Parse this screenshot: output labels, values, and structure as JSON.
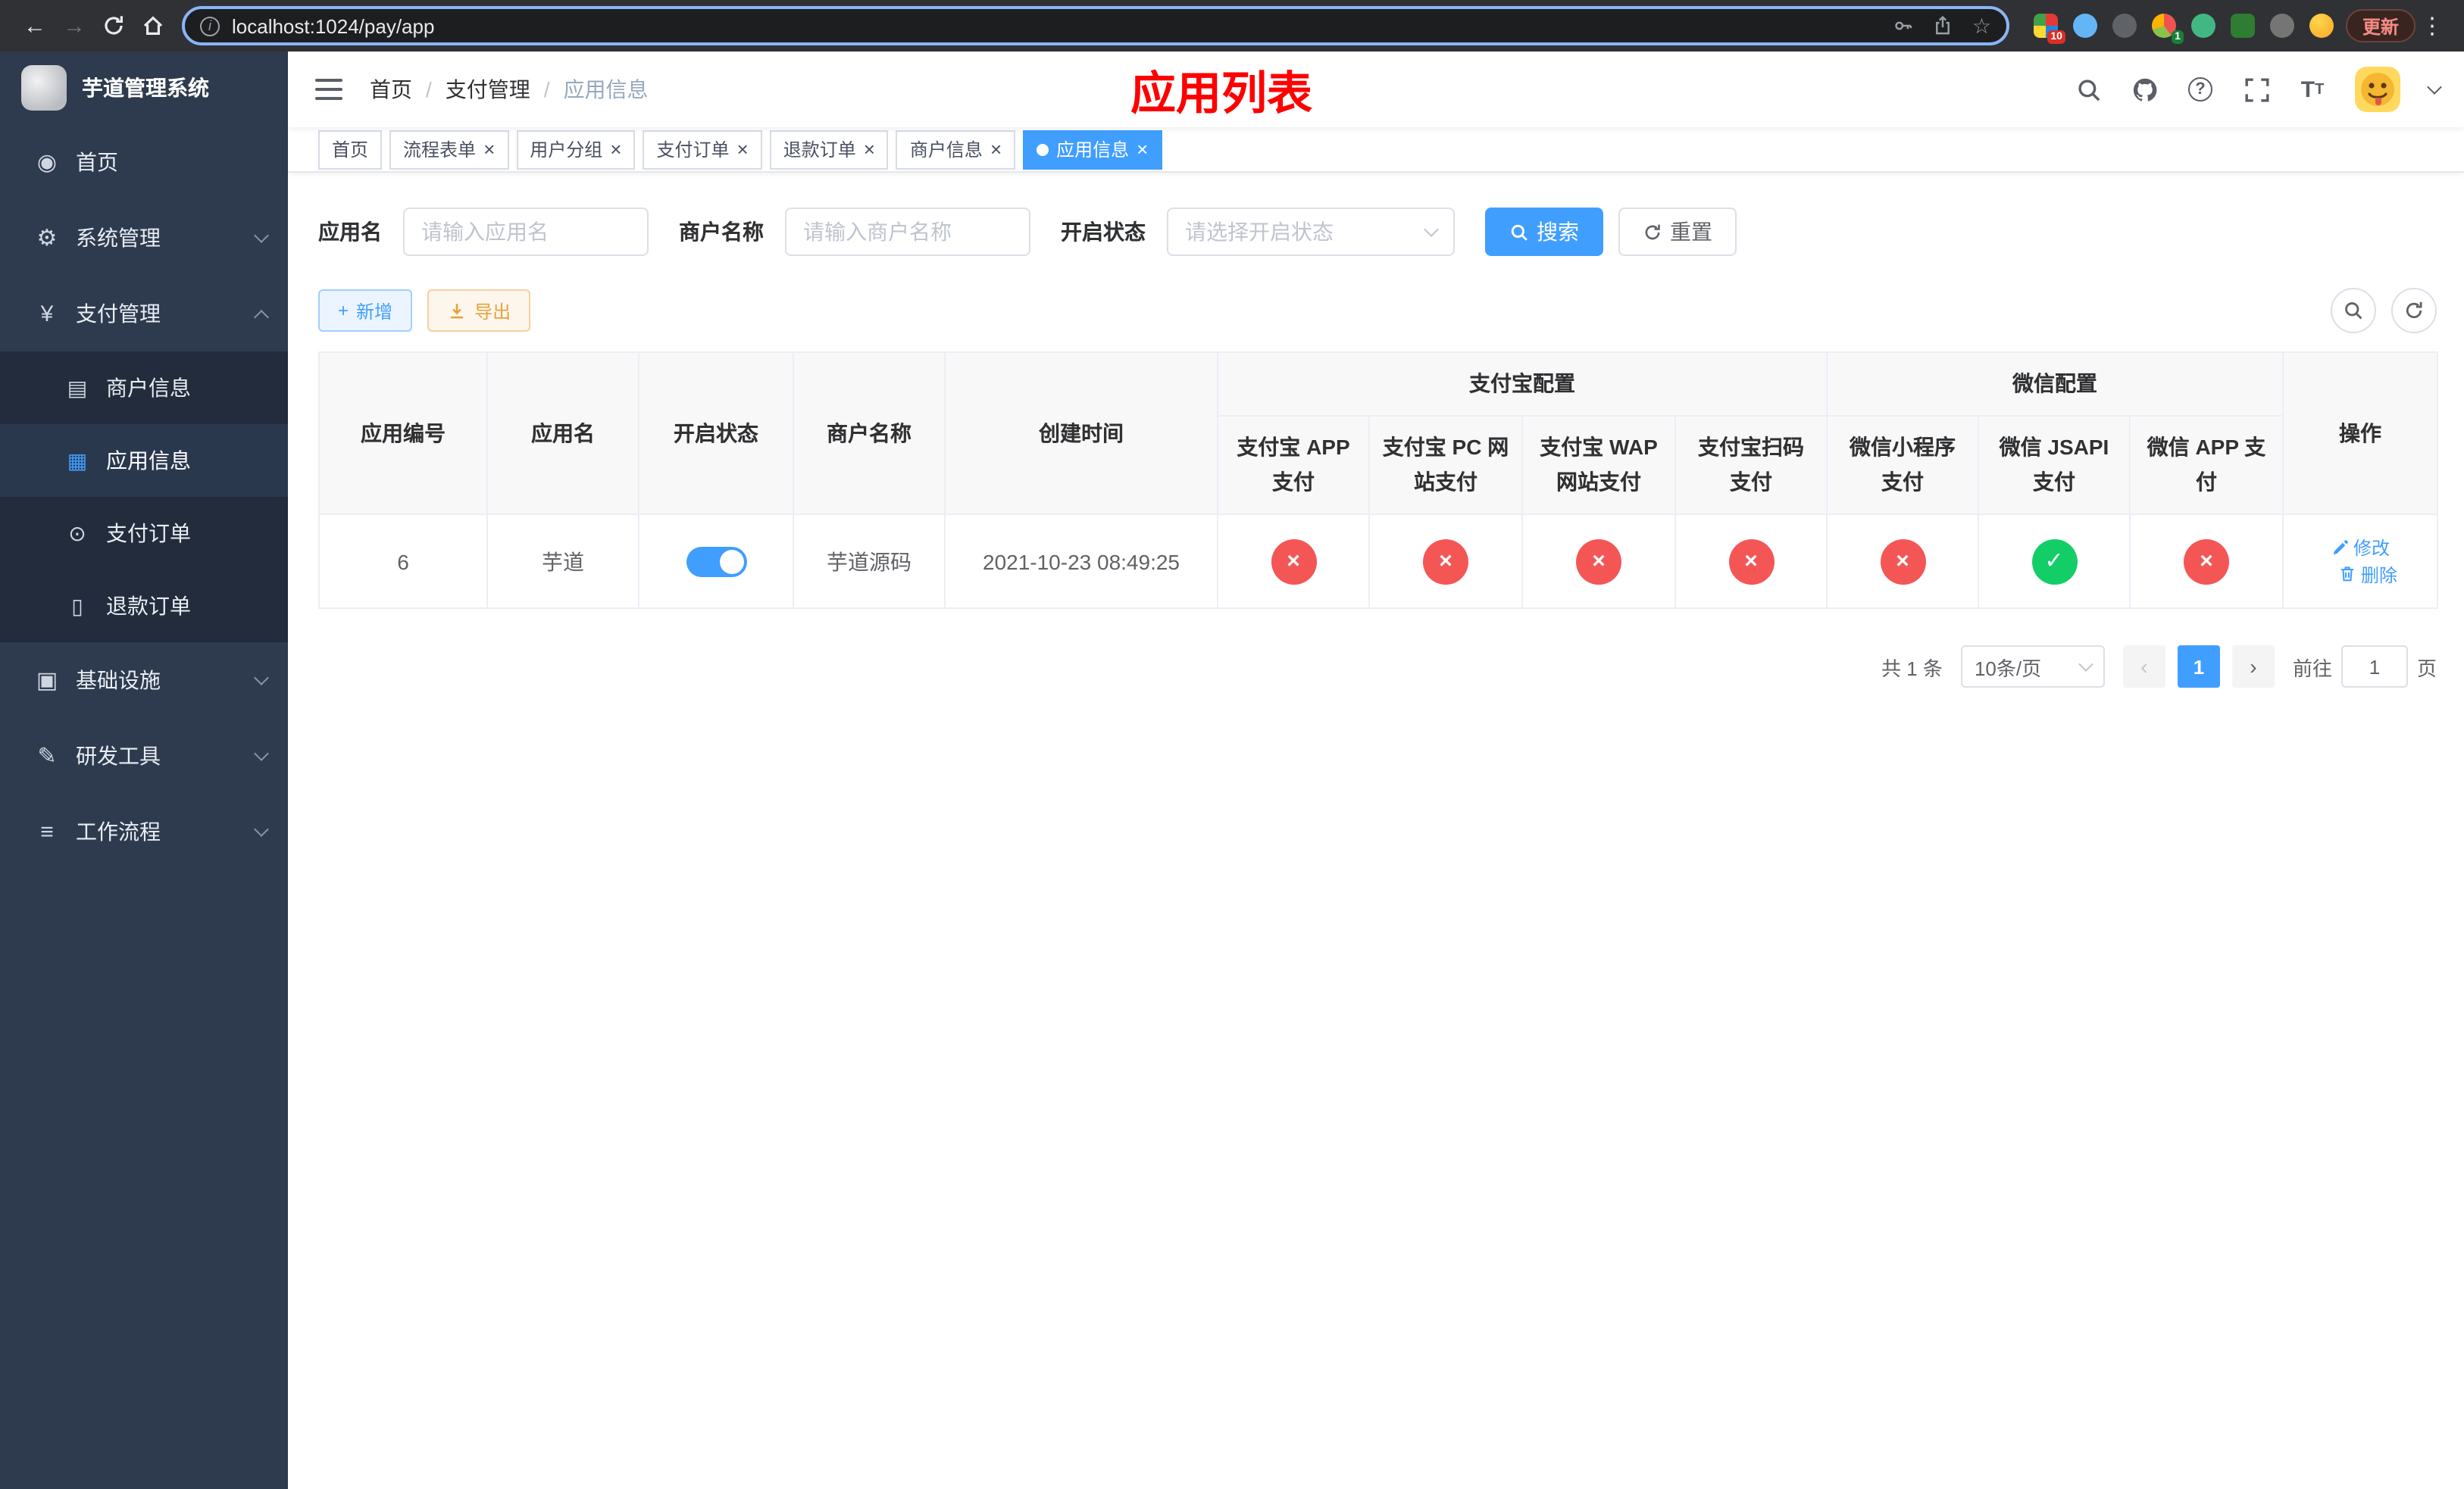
{
  "colors": {
    "accent": "#409eff",
    "success": "#13ce66",
    "danger": "#f45656",
    "warning": "#e6a23c",
    "title_red": "#ff0000"
  },
  "icons": {
    "back": "←",
    "forward": "→",
    "menu_dots": "⋮",
    "info": "i",
    "star": "☆",
    "dashboard": "◉",
    "gear": "⚙",
    "yen": "¥",
    "card": "▤",
    "grid": "▦",
    "order": "⊙",
    "doc": "▯",
    "infra": "▣",
    "tools": "✎",
    "flow": "≡",
    "plus": "+",
    "question": "?",
    "font_size": "T",
    "prev": "‹",
    "next": "›",
    "close": "×"
  },
  "browser": {
    "url": "localhost:1024/pay/app",
    "update_label": "更新",
    "extension_badges": {
      "first": "10",
      "second": "1"
    }
  },
  "sidebar": {
    "title": "芋道管理系统",
    "items": [
      {
        "label": "首页"
      },
      {
        "label": "系统管理"
      },
      {
        "label": "支付管理"
      },
      {
        "label": "基础设施"
      },
      {
        "label": "研发工具"
      },
      {
        "label": "工作流程"
      }
    ],
    "payment_children": [
      {
        "label": "商户信息"
      },
      {
        "label": "应用信息"
      },
      {
        "label": "支付订单"
      },
      {
        "label": "退款订单"
      }
    ]
  },
  "header": {
    "breadcrumb": [
      "首页",
      "支付管理",
      "应用信息"
    ],
    "separator": "/",
    "page_title": "应用列表"
  },
  "tags": [
    {
      "label": "首页"
    },
    {
      "label": "流程表单"
    },
    {
      "label": "用户分组"
    },
    {
      "label": "支付订单"
    },
    {
      "label": "退款订单"
    },
    {
      "label": "商户信息"
    },
    {
      "label": "应用信息"
    }
  ],
  "filters": {
    "app_name_label": "应用名",
    "app_name_placeholder": "请输入应用名",
    "merchant_label": "商户名称",
    "merchant_placeholder": "请输入商户名称",
    "status_label": "开启状态",
    "status_placeholder": "请选择开启状态",
    "search_label": "搜索",
    "reset_label": "重置"
  },
  "toolbar": {
    "add_label": "新增",
    "export_label": "导出"
  },
  "table": {
    "group_alipay": "支付宝配置",
    "group_wechat": "微信配置",
    "columns": [
      "应用编号",
      "应用名",
      "开启状态",
      "商户名称",
      "创建时间",
      "支付宝 APP 支付",
      "支付宝 PC 网站支付",
      "支付宝 WAP 网站支付",
      "支付宝扫码支付",
      "微信小程序支付",
      "微信 JSAPI 支付",
      "微信 APP 支付",
      "操作"
    ],
    "status_glyphs": {
      "ok": "✓",
      "fail": "×"
    },
    "rows": [
      {
        "app_id": "6",
        "app_name": "芋道",
        "enabled": true,
        "merchant_name": "芋道源码",
        "create_time": "2021-10-23 08:49:25",
        "statuses": [
          false,
          false,
          false,
          false,
          false,
          true,
          false
        ],
        "edit_label": "修改",
        "delete_label": "删除"
      }
    ]
  },
  "pagination": {
    "total_text": "共 1 条",
    "page_size_text": "10条/页",
    "current_page": "1",
    "goto_label": "前往",
    "goto_value": "1",
    "goto_suffix": "页"
  }
}
